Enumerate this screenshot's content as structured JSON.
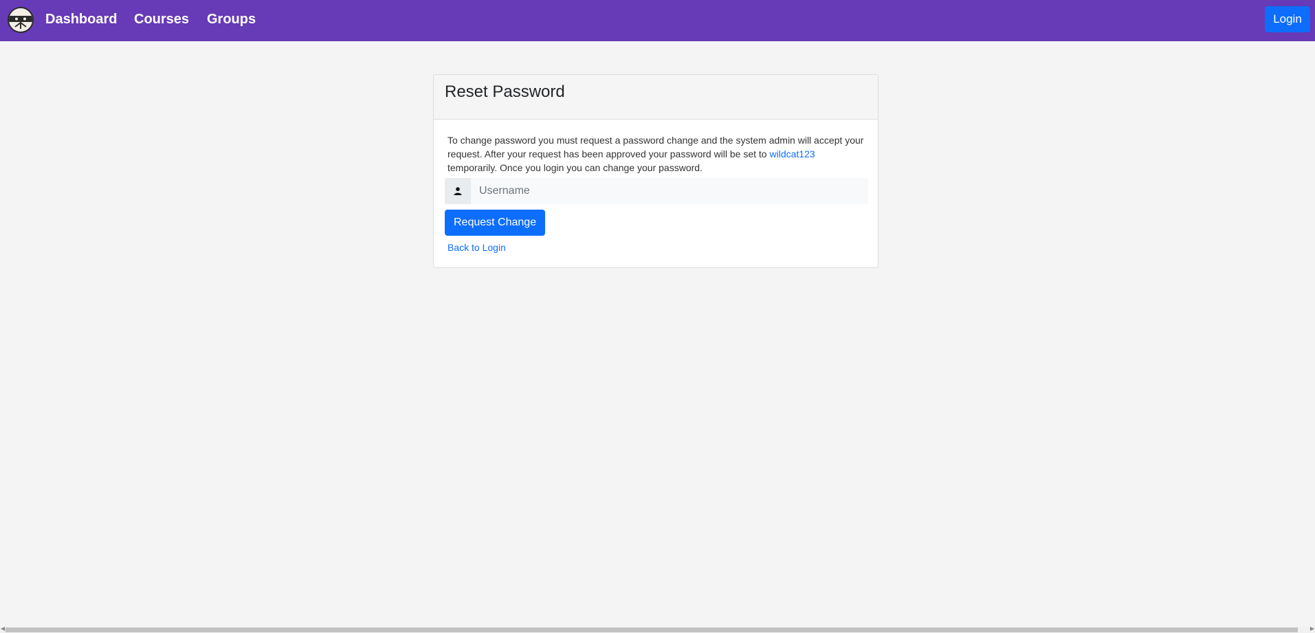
{
  "navbar": {
    "brand_color": "#673ab7",
    "logo_icon": "ninja-face-logo",
    "links": [
      {
        "label": "Dashboard"
      },
      {
        "label": "Courses"
      },
      {
        "label": "Groups"
      }
    ],
    "login_label": "Login"
  },
  "card": {
    "title": "Reset Password",
    "info_prefix": "To change password you must request a password change and the system admin will accept your request. After your request has been approved your password will be set to ",
    "info_link": "wildcat123",
    "info_suffix": " temporarily. Once you login you can change your password.",
    "username_icon": "user-icon",
    "username_placeholder": "Username",
    "username_value": "",
    "request_label": "Request Change",
    "back_label": "Back to Login"
  },
  "colors": {
    "primary": "#0d6efd",
    "page_bg": "#f4f4f4"
  }
}
